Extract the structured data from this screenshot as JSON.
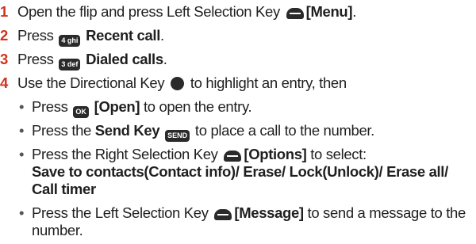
{
  "steps": [
    {
      "num": "1",
      "pre": "Open the flip and press Left Selection Key",
      "key": "menu",
      "bold": "[Menu]",
      "post": "."
    },
    {
      "num": "2",
      "pre": "Press",
      "key_label": "4 ghi",
      "bold": "Recent call",
      "post": "."
    },
    {
      "num": "3",
      "pre": "Press",
      "key_label": "3 def",
      "bold": "Dialed calls",
      "post": "."
    },
    {
      "num": "4",
      "pre": "Use the Directional Key",
      "post": "to highlight an entry, then"
    }
  ],
  "bullets": [
    {
      "pre": "Press",
      "key_label": "OK",
      "bold": "[Open]",
      "post": "to open the entry."
    },
    {
      "pre": "Press the",
      "bold": "Send Key",
      "key_label": "SEND",
      "post": "to place a call to the number."
    },
    {
      "pre": "Press the Right Selection Key",
      "bold": "[Options]",
      "post": "to select:",
      "cont1": "Save to contacts(Contact info)/ Erase/ Lock(Unlock)/ Erase all/",
      "cont2": "Call timer"
    },
    {
      "pre": "Press the Left Selection Key",
      "bold": "[Message]",
      "post": "to send a message to the",
      "cont1": "number."
    }
  ],
  "icons": {
    "left_soft": "left-selection-key-icon",
    "right_soft": "right-selection-key-icon",
    "directional": "directional-key-icon"
  }
}
